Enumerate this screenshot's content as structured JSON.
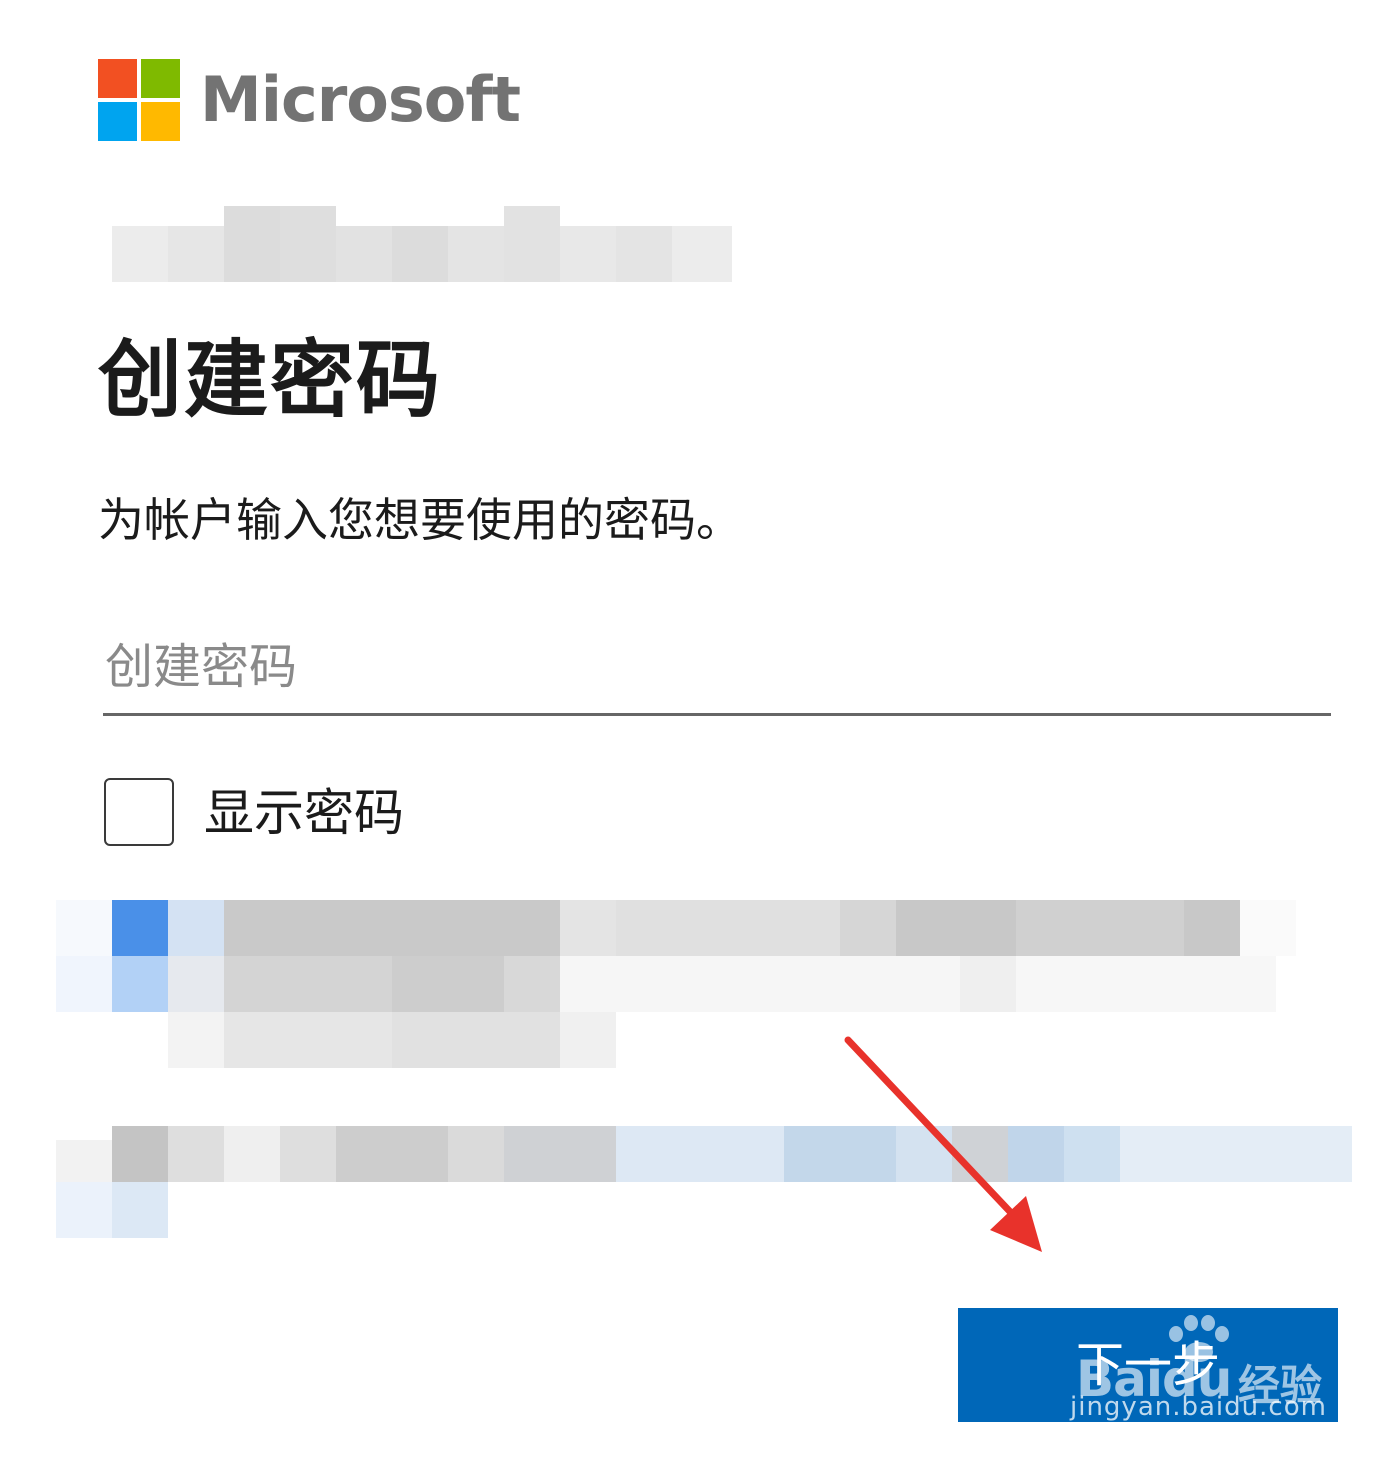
{
  "brand": {
    "name": "Microsoft",
    "colors": {
      "red": "#f25022",
      "green": "#7fba00",
      "blue": "#00a4ef",
      "yellow": "#ffb900",
      "wordmark": "#737373"
    }
  },
  "account_identity": {
    "redacted": true
  },
  "page": {
    "title": "创建密码",
    "description": "为帐户输入您想要使用的密码。"
  },
  "password_field": {
    "placeholder": "创建密码",
    "value": ""
  },
  "show_password": {
    "label": "显示密码",
    "checked": false
  },
  "redacted_sections": [
    {
      "kind": "checkbox-with-text",
      "redacted": true
    },
    {
      "kind": "link-text",
      "redacted": true
    }
  ],
  "next_button": {
    "label": "下一步",
    "color": "#0067b8"
  },
  "watermark": {
    "brand": "Bai",
    "brand_suffix": "du",
    "product": "经验",
    "url": "jingyan.baidu.com"
  },
  "annotation": {
    "type": "arrow",
    "color": "#e8322b"
  }
}
